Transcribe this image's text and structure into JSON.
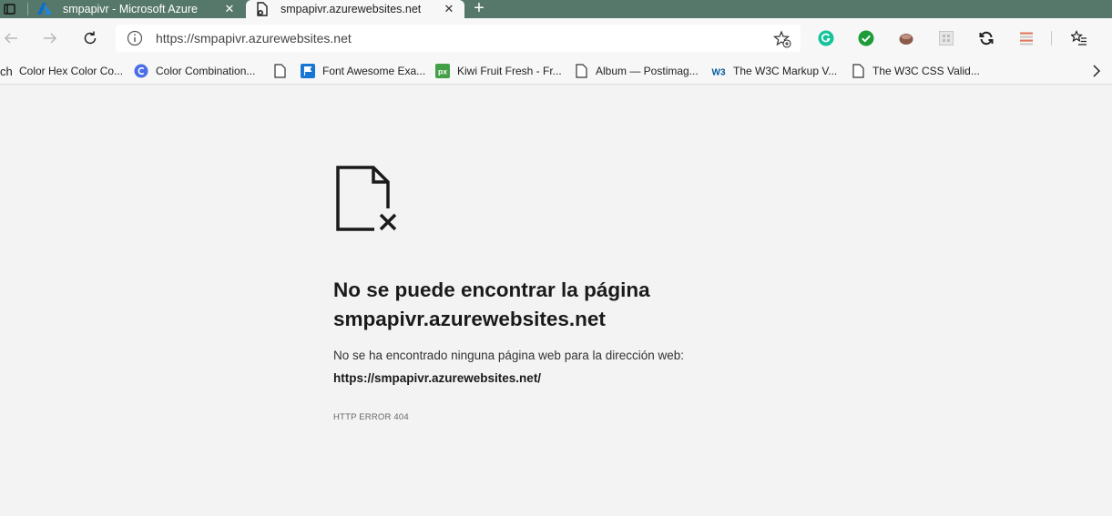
{
  "tabs": [
    {
      "title": "smpapivr - Microsoft Azure",
      "favicon": "azure-icon",
      "active": false
    },
    {
      "title": "smpapivr.azurewebsites.net",
      "favicon": "broken-page-icon",
      "active": true
    }
  ],
  "tab_close_glyph": "✕",
  "newtab_glyph": "+",
  "address_bar": {
    "url": "https://smpapivr.azurewebsites.net"
  },
  "extensions": [
    "grammarly-icon",
    "checkmark-extension-icon",
    "coffee-extension-icon",
    "grid-extension-icon",
    "sync-extension-icon",
    "list-extension-icon",
    "favorites-icon"
  ],
  "bookmarks": [
    {
      "label": "ch",
      "icon": ""
    },
    {
      "label": "Color Hex Color Co...",
      "icon": ""
    },
    {
      "label": "Color Combination...",
      "icon": "c-circle-icon"
    },
    {
      "label": "",
      "icon": "page-icon"
    },
    {
      "label": "Font Awesome Exa...",
      "icon": "flag-icon"
    },
    {
      "label": "Kiwi Fruit Fresh - Fr...",
      "icon": "px-icon"
    },
    {
      "label": "Album — Postimag...",
      "icon": "page-icon"
    },
    {
      "label": "The W3C Markup V...",
      "icon": "w3-icon"
    },
    {
      "label": "The W3C CSS Valid...",
      "icon": "page-icon"
    }
  ],
  "error": {
    "title_line1": "No se puede encontrar la página",
    "title_line2": "smpapivr.azurewebsites.net",
    "description": "No se ha encontrado ninguna página web para la dirección web:",
    "url": "https://smpapivr.azurewebsites.net/",
    "code": "HTTP ERROR 404"
  },
  "colors": {
    "tabstrip": "#56786b",
    "grammarly": "#15c39a",
    "check_ext": "#1e9c3a",
    "flag_bookmark": "#1877d2",
    "px_bookmark": "#43a047",
    "w3_bookmark": "#005a9c",
    "c_circle": "#4b6ee8"
  }
}
